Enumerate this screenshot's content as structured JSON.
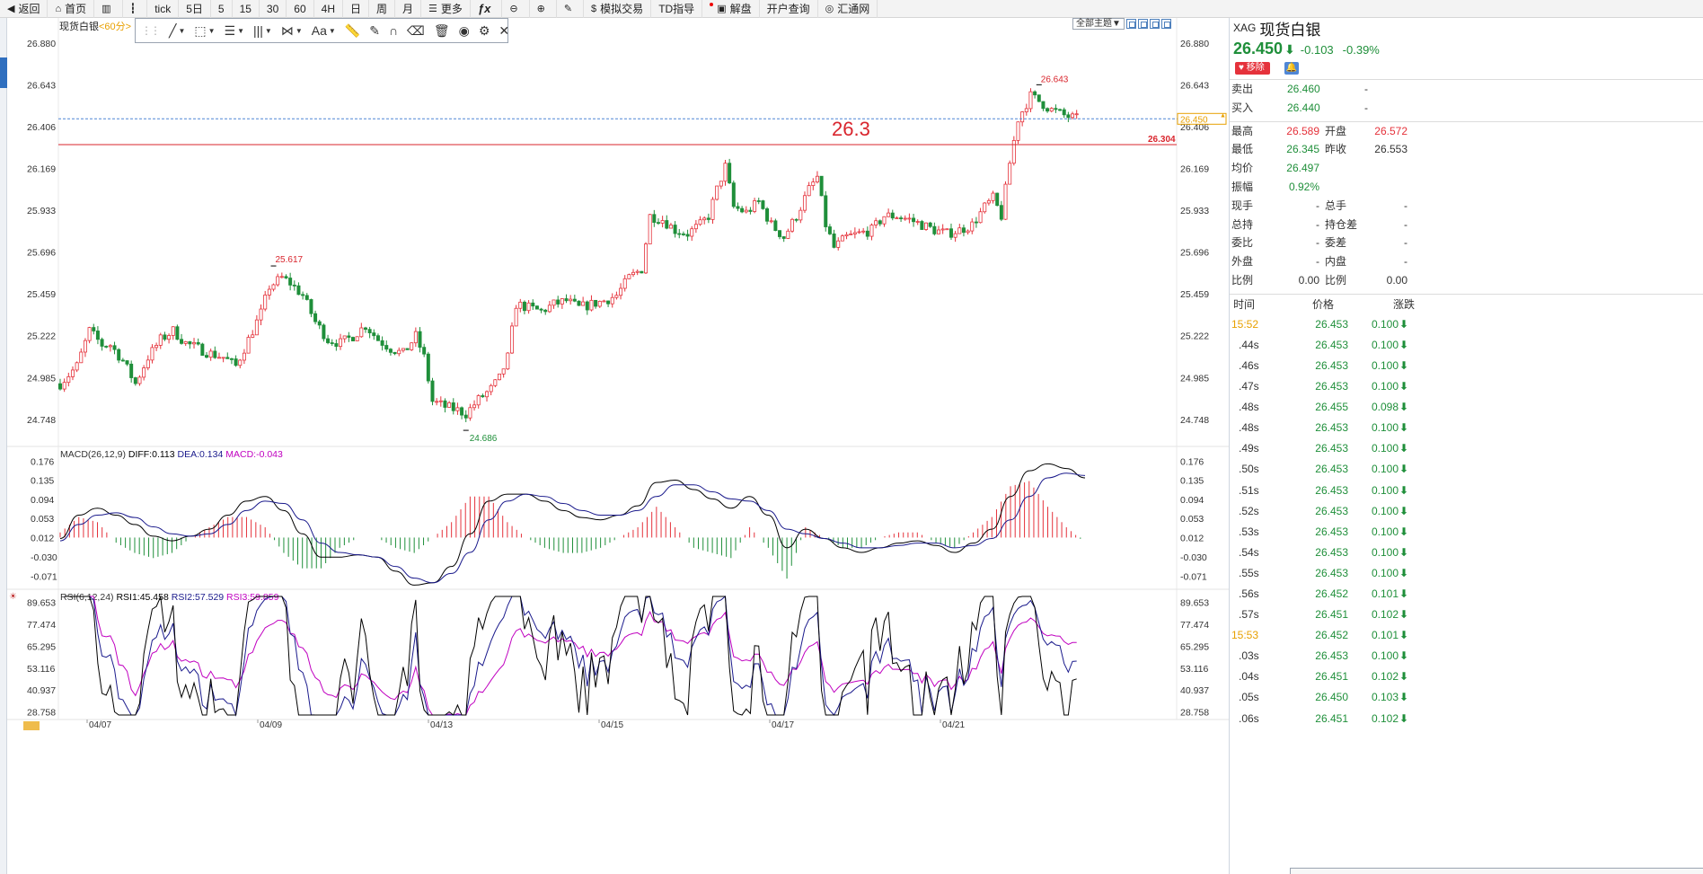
{
  "toolbar": {
    "items": [
      {
        "label": "返回",
        "icon": "back-arrow-icon"
      },
      {
        "label": "首页",
        "icon": "home-icon"
      },
      {
        "label": "",
        "icon": "bar-chart-icon"
      },
      {
        "label": "",
        "icon": "candlestick-icon"
      },
      {
        "label": "tick"
      },
      {
        "label": "5日"
      },
      {
        "label": "5"
      },
      {
        "label": "15"
      },
      {
        "label": "30"
      },
      {
        "label": "60"
      },
      {
        "label": "4H"
      },
      {
        "label": "日"
      },
      {
        "label": "周"
      },
      {
        "label": "月"
      },
      {
        "label": "更多",
        "icon": "list-icon"
      },
      {
        "label": "",
        "icon": "formula-icon"
      },
      {
        "label": "",
        "icon": "zoom-out-icon"
      },
      {
        "label": "",
        "icon": "zoom-in-icon"
      },
      {
        "label": "",
        "icon": "pen-icon"
      },
      {
        "label": "模拟交易",
        "icon": "dollar-icon"
      },
      {
        "label": "TD指导"
      },
      {
        "label": "解盘",
        "icon": "chat-icon"
      },
      {
        "label": "开户查询"
      },
      {
        "label": "汇通网",
        "icon": "logo-icon"
      }
    ]
  },
  "chart": {
    "symbol": "现货白银",
    "period": "<60分>",
    "theme_select": "全部主题▼",
    "annotation_text": "26.3",
    "horizontal_line_label": "26.304",
    "current_price_label": "26.450",
    "high_label": "26.643",
    "low_label": "24.686",
    "peak_label": "25.617",
    "macd_legend": {
      "name": "MACD(26,12,9)",
      "diff": "DIFF:0.113",
      "dea": "DEA:0.134",
      "macd": "MACD:-0.043"
    },
    "rsi_legend": {
      "name": "RSI(6,12,24)",
      "rsi1": "RSI1:45.458",
      "rsi2": "RSI2:57.529",
      "rsi3": "RSI3:59.859"
    },
    "date_labels": [
      "04/07",
      "04/09",
      "04/13",
      "04/15",
      "04/17",
      "04/21"
    ]
  },
  "chart_data": [
    {
      "type": "candlestick",
      "title": "现货白银 <60分>",
      "ylim": [
        24.6,
        26.95
      ],
      "yticks": [
        "26.880",
        "26.643",
        "26.406",
        "26.169",
        "25.933",
        "25.696",
        "25.459",
        "25.222",
        "24.985",
        "24.748"
      ],
      "path_points": [
        [
          0,
          24.95
        ],
        [
          4,
          25.05
        ],
        [
          7,
          25.25
        ],
        [
          10,
          25.17
        ],
        [
          12,
          25.17
        ],
        [
          15,
          25.08
        ],
        [
          18,
          24.95
        ],
        [
          21,
          25.1
        ],
        [
          24,
          25.2
        ],
        [
          27,
          25.25
        ],
        [
          30,
          25.18
        ],
        [
          33,
          25.15
        ],
        [
          36,
          25.12
        ],
        [
          39,
          25.1
        ],
        [
          42,
          25.05
        ],
        [
          45,
          25.2
        ],
        [
          48,
          25.35
        ],
        [
          50,
          25.5
        ],
        [
          53,
          25.55
        ],
        [
          55,
          25.52
        ],
        [
          58,
          25.45
        ],
        [
          61,
          25.3
        ],
        [
          64,
          25.2
        ],
        [
          67,
          25.18
        ],
        [
          70,
          25.22
        ],
        [
          73,
          25.28
        ],
        [
          76,
          25.2
        ],
        [
          79,
          25.15
        ],
        [
          82,
          25.12
        ],
        [
          85,
          25.22
        ],
        [
          87,
          25.1
        ],
        [
          89,
          24.85
        ],
        [
          92,
          24.82
        ],
        [
          95,
          24.8
        ],
        [
          97,
          24.78
        ],
        [
          100,
          24.86
        ],
        [
          103,
          24.92
        ],
        [
          105,
          24.98
        ],
        [
          107,
          25.1
        ],
        [
          109,
          25.4
        ],
        [
          112,
          25.38
        ],
        [
          115,
          25.36
        ],
        [
          118,
          25.4
        ],
        [
          121,
          25.42
        ],
        [
          124,
          25.38
        ],
        [
          127,
          25.4
        ],
        [
          130,
          25.42
        ],
        [
          133,
          25.45
        ],
        [
          136,
          25.55
        ],
        [
          139,
          25.6
        ],
        [
          141,
          25.9
        ],
        [
          144,
          25.88
        ],
        [
          147,
          25.82
        ],
        [
          150,
          25.8
        ],
        [
          153,
          25.85
        ],
        [
          155,
          25.9
        ],
        [
          157,
          26.05
        ],
        [
          159,
          26.18
        ],
        [
          161,
          25.95
        ],
        [
          164,
          25.92
        ],
        [
          167,
          25.98
        ],
        [
          170,
          25.85
        ],
        [
          173,
          25.78
        ],
        [
          176,
          25.9
        ],
        [
          179,
          26.05
        ],
        [
          181,
          26.12
        ],
        [
          183,
          25.85
        ],
        [
          185,
          25.72
        ],
        [
          188,
          25.78
        ],
        [
          191,
          25.8
        ],
        [
          194,
          25.82
        ],
        [
          197,
          25.9
        ],
        [
          200,
          25.9
        ],
        [
          203,
          25.88
        ],
        [
          206,
          25.85
        ],
        [
          209,
          25.82
        ],
        [
          212,
          25.8
        ],
        [
          215,
          25.82
        ],
        [
          218,
          25.85
        ],
        [
          221,
          25.95
        ],
        [
          223,
          26.0
        ],
        [
          225,
          25.9
        ],
        [
          227,
          26.2
        ],
        [
          229,
          26.45
        ],
        [
          232,
          26.58
        ],
        [
          234,
          26.55
        ],
        [
          237,
          26.5
        ],
        [
          240,
          26.47
        ],
        [
          243,
          26.45
        ]
      ],
      "high": 26.643,
      "low": 24.686,
      "last": 26.45,
      "annotations": [
        "26.643",
        "24.686",
        "25.617",
        "26.304",
        "26.3"
      ]
    },
    {
      "type": "line",
      "title": "MACD(26,12,9)",
      "yticks": [
        "0.176",
        "0.135",
        "0.094",
        "0.053",
        "0.012",
        "-0.030",
        "-0.071"
      ],
      "ylim": [
        -0.095,
        0.19
      ],
      "series": [
        {
          "name": "DIFF",
          "values": [
            0.01,
            0.06,
            0.075,
            0.06,
            0.04,
            0.015,
            0.005,
            0.015,
            0.03,
            0.06,
            0.09,
            0.1,
            0.07,
            0.02,
            -0.03,
            -0.03,
            -0.025,
            -0.03,
            -0.06,
            -0.09,
            -0.085,
            -0.05,
            0.02,
            0.09,
            0.105,
            0.105,
            0.09,
            0.07,
            0.055,
            0.05,
            0.06,
            0.08,
            0.13,
            0.135,
            0.115,
            0.095,
            0.075,
            0.1,
            0.06,
            -0.01,
            0.03,
            0.01,
            -0.01,
            -0.02,
            -0.01,
            0.0,
            0.005,
            -0.005,
            -0.02,
            0.0,
            0.03,
            0.1,
            0.155,
            0.17,
            0.16,
            0.14
          ]
        },
        {
          "name": "DEA",
          "values": [
            0.005,
            0.04,
            0.06,
            0.065,
            0.055,
            0.035,
            0.02,
            0.015,
            0.02,
            0.04,
            0.07,
            0.09,
            0.085,
            0.05,
            0.0,
            -0.02,
            -0.025,
            -0.03,
            -0.05,
            -0.075,
            -0.085,
            -0.065,
            -0.02,
            0.05,
            0.09,
            0.105,
            0.1,
            0.085,
            0.07,
            0.06,
            0.06,
            0.07,
            0.1,
            0.125,
            0.125,
            0.11,
            0.095,
            0.09,
            0.07,
            0.03,
            0.02,
            0.01,
            0.0,
            -0.01,
            -0.01,
            -0.005,
            0.0,
            0.0,
            -0.01,
            -0.005,
            0.01,
            0.05,
            0.1,
            0.14,
            0.15,
            0.145
          ]
        },
        {
          "name": "MACD",
          "values": []
        }
      ]
    },
    {
      "type": "line",
      "title": "RSI(6,12,24)",
      "yticks": [
        "89.653",
        "77.474",
        "65.295",
        "53.116",
        "40.937",
        "28.758"
      ],
      "ylim": [
        25,
        95
      ],
      "series": [
        {
          "name": "RSI1",
          "values": []
        },
        {
          "name": "RSI2",
          "values": []
        },
        {
          "name": "RSI3",
          "values": []
        }
      ]
    }
  ],
  "panel": {
    "code": "XAG",
    "name": "现货白银",
    "price": "26.450",
    "change": "-0.103",
    "change_pct": "-0.39%",
    "remove_label": "移除",
    "rows_top": [
      {
        "l": "卖出",
        "v": "26.460",
        "l2": "-",
        "v2": ""
      },
      {
        "l": "买入",
        "v": "26.440",
        "l2": "-",
        "v2": ""
      }
    ],
    "rows_stats": [
      {
        "l": "最高",
        "v": "26.589",
        "vc": "red",
        "l2": "开盘",
        "v2": "26.572",
        "v2c": "red"
      },
      {
        "l": "最低",
        "v": "26.345",
        "vc": "green",
        "l2": "昨收",
        "v2": "26.553",
        "v2c": "dash"
      },
      {
        "l": "均价",
        "v": "26.497",
        "vc": "green",
        "l2": "",
        "v2": "",
        "v2c": ""
      },
      {
        "l": "振幅",
        "v": "0.92%",
        "vc": "green",
        "l2": "",
        "v2": "",
        "v2c": ""
      },
      {
        "l": "现手",
        "v": "-",
        "vc": "dash",
        "l2": "总手",
        "v2": "-",
        "v2c": "dash"
      },
      {
        "l": "总持",
        "v": "-",
        "vc": "dash",
        "l2": "持仓差",
        "v2": "-",
        "v2c": "dash"
      },
      {
        "l": "委比",
        "v": "-",
        "vc": "dash",
        "l2": "委差",
        "v2": "-",
        "v2c": "dash"
      },
      {
        "l": "外盘",
        "v": "-",
        "vc": "dash",
        "l2": "内盘",
        "v2": "-",
        "v2c": "dash"
      },
      {
        "l": "比例",
        "v": "0.00",
        "vc": "dash",
        "l2": "比例",
        "v2": "0.00",
        "v2c": "dash"
      }
    ],
    "trades_header": {
      "time": "时间",
      "price": "价格",
      "vol": "涨跌"
    },
    "trades": [
      {
        "t": "15:52",
        "min": true,
        "p": "26.453",
        "v": "0.100"
      },
      {
        "t": ".44s",
        "min": false,
        "p": "26.453",
        "v": "0.100"
      },
      {
        "t": ".46s",
        "min": false,
        "p": "26.453",
        "v": "0.100"
      },
      {
        "t": ".47s",
        "min": false,
        "p": "26.453",
        "v": "0.100"
      },
      {
        "t": ".48s",
        "min": false,
        "p": "26.455",
        "v": "0.098"
      },
      {
        "t": ".48s",
        "min": false,
        "p": "26.453",
        "v": "0.100"
      },
      {
        "t": ".49s",
        "min": false,
        "p": "26.453",
        "v": "0.100"
      },
      {
        "t": ".50s",
        "min": false,
        "p": "26.453",
        "v": "0.100"
      },
      {
        "t": ".51s",
        "min": false,
        "p": "26.453",
        "v": "0.100"
      },
      {
        "t": ".52s",
        "min": false,
        "p": "26.453",
        "v": "0.100"
      },
      {
        "t": ".53s",
        "min": false,
        "p": "26.453",
        "v": "0.100"
      },
      {
        "t": ".54s",
        "min": false,
        "p": "26.453",
        "v": "0.100"
      },
      {
        "t": ".55s",
        "min": false,
        "p": "26.453",
        "v": "0.100"
      },
      {
        "t": ".56s",
        "min": false,
        "p": "26.452",
        "v": "0.101"
      },
      {
        "t": ".57s",
        "min": false,
        "p": "26.451",
        "v": "0.102"
      },
      {
        "t": "15:53",
        "min": true,
        "p": "26.452",
        "v": "0.101"
      },
      {
        "t": ".03s",
        "min": false,
        "p": "26.453",
        "v": "0.100"
      },
      {
        "t": ".04s",
        "min": false,
        "p": "26.451",
        "v": "0.102"
      },
      {
        "t": ".05s",
        "min": false,
        "p": "26.450",
        "v": "0.103"
      },
      {
        "t": ".06s",
        "min": false,
        "p": "26.451",
        "v": "0.102"
      }
    ]
  },
  "colors": {
    "up": "#e5323b",
    "down": "#1f8f3a",
    "diff": "#000000",
    "dea": "#1a1a8c",
    "rsi3": "#c000c0",
    "resistance": "#d9252d",
    "current": "#4f86d6"
  }
}
